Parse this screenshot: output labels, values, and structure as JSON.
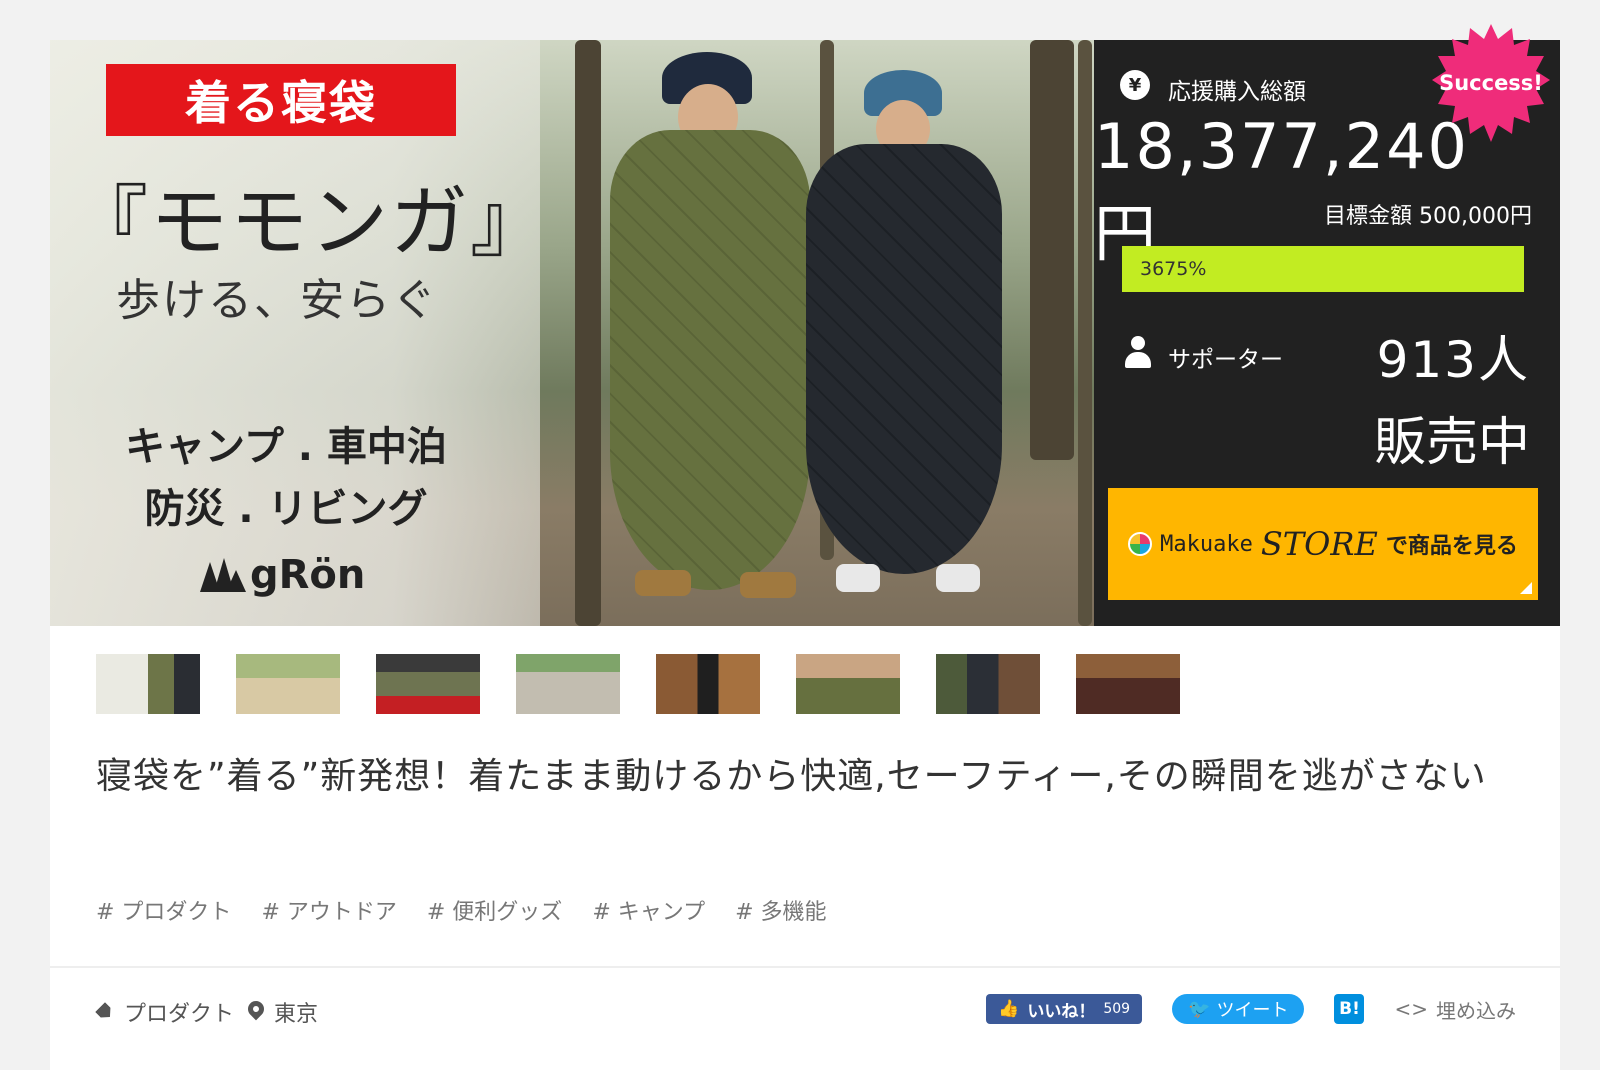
{
  "hero": {
    "red_label": "着る寝袋",
    "title": "『モモンガ』",
    "subtitle": "歩ける、安らぐ",
    "use_line1": "キャンプ . 車中泊",
    "use_line2": "防災 . リビング",
    "brand": "gRön"
  },
  "stats": {
    "total_label": "応援購入総額",
    "total_value": "18,377,240円",
    "goal_text": "目標金額 500,000円",
    "progress_text": "3675%",
    "progress_fraction": 1.0,
    "supporters_label": "サポーター",
    "supporters_value": "913人",
    "status": "販売中",
    "yen_symbol": "¥",
    "success_badge": "Success!",
    "store_button": {
      "brand": "Makuake",
      "script": "STORE",
      "suffix": "で商品を見る"
    },
    "colors": {
      "panel": "#212121",
      "progress": "#c2ec22",
      "store": "#ffb600",
      "badge": "#ef2c7a"
    }
  },
  "project": {
    "title": "寝袋を”着る”新発想！着たまま動けるから快適,セーフティー,その瞬間を逃がさない",
    "tags": [
      "# プロダクト",
      "# アウトドア",
      "# 便利グッズ",
      "# キャンプ",
      "# 多機能"
    ]
  },
  "meta": {
    "category": "プロダクト",
    "location": "東京",
    "fb_label": "いいね！",
    "fb_count": "509",
    "tweet_label": "ツイート",
    "hatena_label": "B!",
    "embed_label": "埋め込み",
    "embed_icon": "<>"
  }
}
